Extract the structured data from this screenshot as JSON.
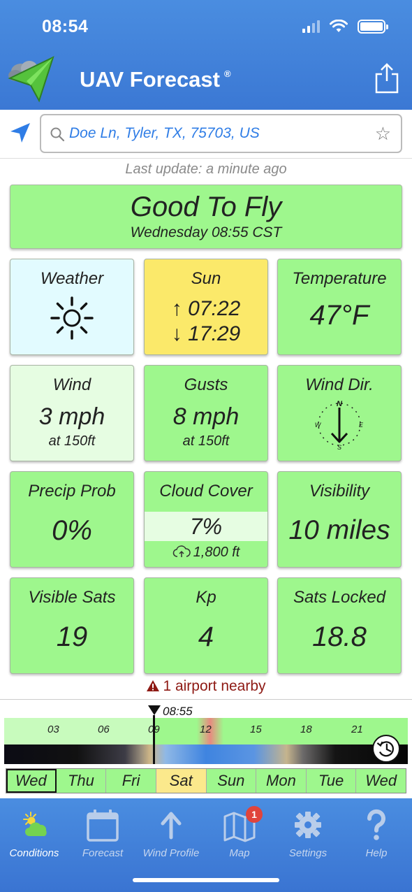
{
  "status_bar": {
    "time": "08:54"
  },
  "app": {
    "title": "UAV Forecast",
    "trademark": "®"
  },
  "search": {
    "location": "Doe Ln, Tyler, TX, 75703, US"
  },
  "last_update": "Last update: a minute ago",
  "banner": {
    "title": "Good To Fly",
    "subtitle": "Wednesday 08:55 CST"
  },
  "tiles": {
    "weather": {
      "title": "Weather",
      "icon": "sun-icon"
    },
    "sun": {
      "title": "Sun",
      "sunrise": "↑ 07:22",
      "sunset": "↓ 17:29"
    },
    "temperature": {
      "title": "Temperature",
      "value": "47°F"
    },
    "wind": {
      "title": "Wind",
      "value": "3 mph",
      "note": "at 150ft"
    },
    "gusts": {
      "title": "Gusts",
      "value": "8 mph",
      "note": "at 150ft"
    },
    "wind_dir": {
      "title": "Wind Dir.",
      "n": "N",
      "e": "E",
      "s": "S",
      "w": "W"
    },
    "precip": {
      "title": "Precip Prob",
      "value": "0%"
    },
    "cloud": {
      "title": "Cloud Cover",
      "value": "7%",
      "base": "1,800 ft"
    },
    "visibility": {
      "title": "Visibility",
      "value": "10 miles"
    },
    "visible_sats": {
      "title": "Visible Sats",
      "value": "19"
    },
    "kp": {
      "title": "Kp",
      "value": "4"
    },
    "sats_locked": {
      "title": "Sats Locked",
      "value": "18.8"
    }
  },
  "airport_warning": "1 airport nearby",
  "timeline": {
    "now_label": "08:55",
    "hours": [
      "03",
      "06",
      "09",
      "12",
      "15",
      "18",
      "21"
    ],
    "days": [
      "Wed",
      "Thu",
      "Fri",
      "Sat",
      "Sun",
      "Mon",
      "Tue",
      "Wed"
    ]
  },
  "tabbar": {
    "conditions": "Conditions",
    "forecast": "Forecast",
    "wind_profile": "Wind Profile",
    "map": "Map",
    "map_badge": "1",
    "settings": "Settings",
    "help": "Help"
  },
  "colors": {
    "header_blue": "#3b78d4",
    "good_green": "#9ef78d",
    "sun_yellow": "#fbe96a",
    "warning_red": "#8e1a14"
  }
}
